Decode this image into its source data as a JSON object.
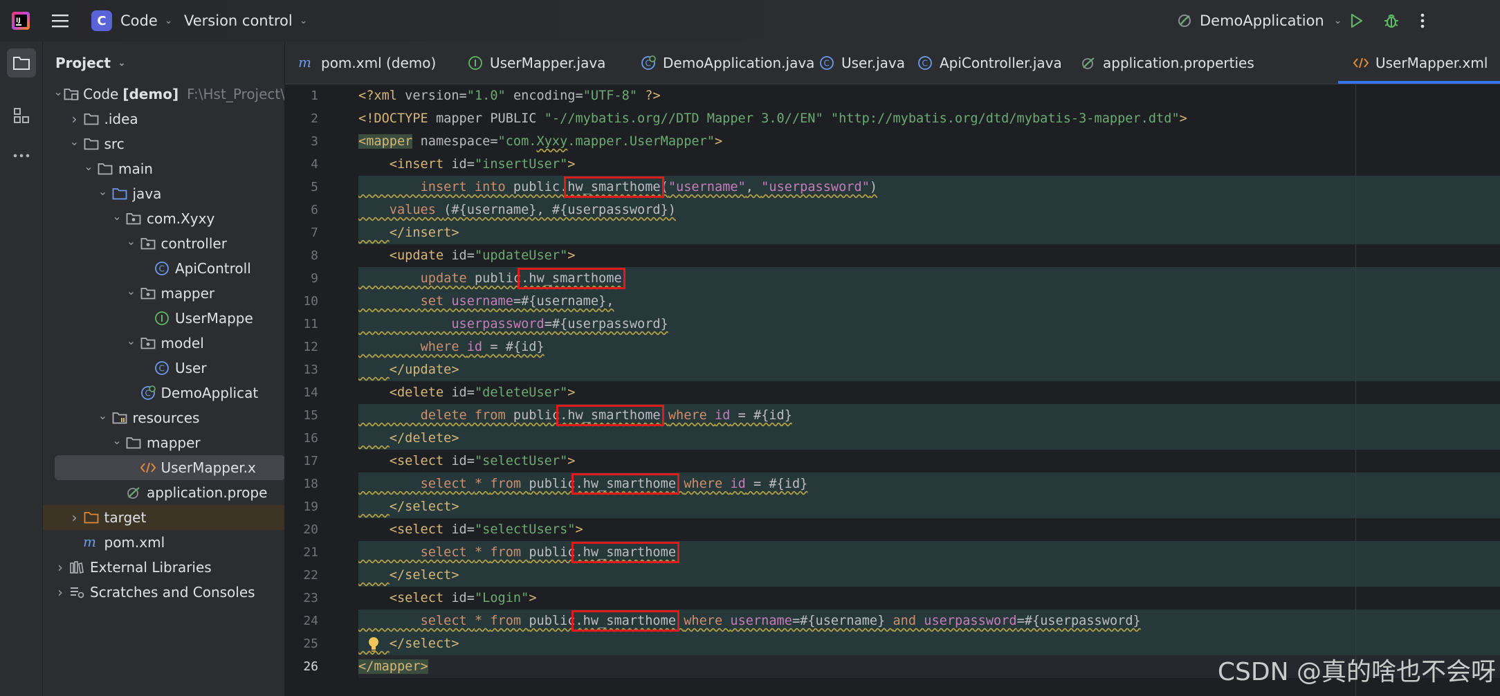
{
  "titlebar": {
    "project_initial": "C",
    "project_name": "Code",
    "vcs_label": "Version control",
    "run_config": "DemoApplication"
  },
  "project_panel": {
    "title": "Project",
    "tree": [
      {
        "label": "Code",
        "bold_suffix": "[demo]",
        "hint": "F:\\Hst_Project\\",
        "icon": "module-folder-icon",
        "expanded": true
      },
      {
        "label": ".idea",
        "icon": "folder-icon",
        "expanded": false
      },
      {
        "label": "src",
        "icon": "folder-icon",
        "expanded": true
      },
      {
        "label": "main",
        "icon": "folder-icon",
        "expanded": true
      },
      {
        "label": "java",
        "icon": "source-folder-icon",
        "expanded": true
      },
      {
        "label": "com.Xyxy",
        "icon": "package-icon",
        "expanded": true
      },
      {
        "label": "controller",
        "icon": "package-icon",
        "expanded": true
      },
      {
        "label": "ApiControll",
        "icon": "class-icon"
      },
      {
        "label": "mapper",
        "icon": "package-icon",
        "expanded": true
      },
      {
        "label": "UserMappe",
        "icon": "interface-icon"
      },
      {
        "label": "model",
        "icon": "package-icon",
        "expanded": true
      },
      {
        "label": "User",
        "icon": "class-icon"
      },
      {
        "label": "DemoApplicat",
        "icon": "spring-class-icon"
      },
      {
        "label": "resources",
        "icon": "resources-folder-icon",
        "expanded": true
      },
      {
        "label": "mapper",
        "icon": "folder-icon",
        "expanded": true
      },
      {
        "label": "UserMapper.x",
        "icon": "xml-icon"
      },
      {
        "label": "application.prope",
        "icon": "spring-properties-icon"
      },
      {
        "label": "target",
        "icon": "excluded-folder-icon",
        "expanded": false
      },
      {
        "label": "pom.xml",
        "icon": "maven-icon"
      },
      {
        "label": "External Libraries",
        "icon": "libraries-icon",
        "expanded": false
      },
      {
        "label": "Scratches and Consoles",
        "icon": "scratches-icon",
        "expanded": false
      }
    ]
  },
  "tabs": [
    {
      "label": "pom.xml (demo)",
      "icon": "maven-icon"
    },
    {
      "label": "UserMapper.java",
      "icon": "interface-icon"
    },
    {
      "label": "DemoApplication.java",
      "icon": "spring-class-icon"
    },
    {
      "label": "User.java",
      "icon": "class-icon"
    },
    {
      "label": "ApiController.java",
      "icon": "class-icon"
    },
    {
      "label": "application.properties",
      "icon": "spring-properties-icon"
    },
    {
      "label": "UserMapper.xml",
      "icon": "xml-icon",
      "active": true
    }
  ],
  "editor": {
    "line_numbers": [
      "1",
      "2",
      "3",
      "4",
      "5",
      "6",
      "7",
      "8",
      "9",
      "10",
      "11",
      "12",
      "13",
      "14",
      "15",
      "16",
      "17",
      "18",
      "19",
      "20",
      "21",
      "22",
      "23",
      "24",
      "25",
      "26"
    ],
    "lines": [
      [
        {
          "t": "<?xml ",
          "c": "t-decl"
        },
        {
          "t": "version",
          "c": "t-attr"
        },
        {
          "t": "=",
          "c": "t-txt"
        },
        {
          "t": "\"1.0\"",
          "c": "t-val"
        },
        {
          "t": " ",
          "c": "t-txt"
        },
        {
          "t": "encoding",
          "c": "t-attr"
        },
        {
          "t": "=",
          "c": "t-txt"
        },
        {
          "t": "\"UTF-8\"",
          "c": "t-val"
        },
        {
          "t": " ?>",
          "c": "t-decl"
        }
      ],
      [
        {
          "t": "<!DOCTYPE ",
          "c": "t-decl"
        },
        {
          "t": "mapper PUBLIC ",
          "c": "t-txt"
        },
        {
          "t": "\"-//mybatis.org//DTD Mapper 3.0//EN\"",
          "c": "t-val"
        },
        {
          "t": " ",
          "c": "t-txt"
        },
        {
          "t": "\"http://mybatis.org/dtd/mybatis-3-mapper.dtd\"",
          "c": "t-val"
        },
        {
          "t": ">",
          "c": "t-decl"
        }
      ],
      [
        {
          "t": "<mapper",
          "c": "t-tag hl-mapper"
        },
        {
          "t": " ",
          "c": "t-txt"
        },
        {
          "t": "namespace",
          "c": "t-attr"
        },
        {
          "t": "=",
          "c": "t-txt"
        },
        {
          "t": "\"com.",
          "c": "t-val"
        },
        {
          "t": "Xyxy",
          "c": "t-val warn"
        },
        {
          "t": ".mapper.UserMapper\"",
          "c": "t-val"
        },
        {
          "t": ">",
          "c": "t-tag"
        }
      ],
      [
        {
          "t": "    <insert ",
          "c": "t-tag"
        },
        {
          "t": "id",
          "c": "t-attr"
        },
        {
          "t": "=",
          "c": "t-txt"
        },
        {
          "t": "\"insertUser\"",
          "c": "t-val"
        },
        {
          "t": ">",
          "c": "t-tag"
        }
      ],
      [
        {
          "t": "        ",
          "c": "t-txt warn"
        },
        {
          "t": "insert into ",
          "c": "t-kw warn"
        },
        {
          "t": "public.",
          "c": "t-txt warn"
        },
        {
          "t": "hw_smarthome",
          "c": "t-txt warn redbox"
        },
        {
          "t": "(",
          "c": "t-txt warn"
        },
        {
          "t": "\"username\"",
          "c": "t-col warn"
        },
        {
          "t": ", ",
          "c": "t-txt warn"
        },
        {
          "t": "\"userpassword\"",
          "c": "t-col warn"
        },
        {
          "t": ")",
          "c": "t-txt warn"
        }
      ],
      [
        {
          "t": "    ",
          "c": "t-txt warn"
        },
        {
          "t": "values ",
          "c": "t-kw warn"
        },
        {
          "t": "(#{username}, #{userpassword})",
          "c": "t-txt warn"
        }
      ],
      [
        {
          "t": "    ",
          "c": "t-txt warn"
        },
        {
          "t": "</insert>",
          "c": "t-tag"
        }
      ],
      [
        {
          "t": "    <update ",
          "c": "t-tag"
        },
        {
          "t": "id",
          "c": "t-attr"
        },
        {
          "t": "=",
          "c": "t-txt"
        },
        {
          "t": "\"updateUser\"",
          "c": "t-val"
        },
        {
          "t": ">",
          "c": "t-tag"
        }
      ],
      [
        {
          "t": "        ",
          "c": "t-txt warn"
        },
        {
          "t": "update ",
          "c": "t-kw warn"
        },
        {
          "t": "public",
          "c": "t-txt warn"
        },
        {
          "t": ".hw_smarthome",
          "c": "t-txt warn redbox"
        }
      ],
      [
        {
          "t": "        ",
          "c": "t-txt warn"
        },
        {
          "t": "set ",
          "c": "t-kw warn"
        },
        {
          "t": "username",
          "c": "t-col warn"
        },
        {
          "t": "=#{username},",
          "c": "t-txt warn"
        }
      ],
      [
        {
          "t": "            ",
          "c": "t-txt warn"
        },
        {
          "t": "userpassword",
          "c": "t-col warn"
        },
        {
          "t": "=#{userpassword}",
          "c": "t-txt warn"
        }
      ],
      [
        {
          "t": "        ",
          "c": "t-txt warn"
        },
        {
          "t": "where ",
          "c": "t-kw warn"
        },
        {
          "t": "id",
          "c": "t-col warn"
        },
        {
          "t": " = #{id}",
          "c": "t-txt warn"
        }
      ],
      [
        {
          "t": "    ",
          "c": "t-txt warn"
        },
        {
          "t": "</update>",
          "c": "t-tag"
        }
      ],
      [
        {
          "t": "    <delete ",
          "c": "t-tag"
        },
        {
          "t": "id",
          "c": "t-attr"
        },
        {
          "t": "=",
          "c": "t-txt"
        },
        {
          "t": "\"deleteUser\"",
          "c": "t-val"
        },
        {
          "t": ">",
          "c": "t-tag"
        }
      ],
      [
        {
          "t": "        ",
          "c": "t-txt warn"
        },
        {
          "t": "delete from ",
          "c": "t-kw warn"
        },
        {
          "t": "public",
          "c": "t-txt warn"
        },
        {
          "t": ".hw_smarthome",
          "c": "t-txt warn redbox"
        },
        {
          "t": " ",
          "c": "t-txt warn"
        },
        {
          "t": "where ",
          "c": "t-kw warn"
        },
        {
          "t": "id",
          "c": "t-col warn"
        },
        {
          "t": " = #{id}",
          "c": "t-txt warn"
        }
      ],
      [
        {
          "t": "    ",
          "c": "t-txt warn"
        },
        {
          "t": "</delete>",
          "c": "t-tag"
        }
      ],
      [
        {
          "t": "    <select ",
          "c": "t-tag"
        },
        {
          "t": "id",
          "c": "t-attr"
        },
        {
          "t": "=",
          "c": "t-txt"
        },
        {
          "t": "\"selectUser\"",
          "c": "t-val"
        },
        {
          "t": ">",
          "c": "t-tag"
        }
      ],
      [
        {
          "t": "        ",
          "c": "t-txt warn"
        },
        {
          "t": "select ",
          "c": "t-kw warn"
        },
        {
          "t": "* ",
          "c": "t-kw warn"
        },
        {
          "t": "from ",
          "c": "t-kw warn"
        },
        {
          "t": "public",
          "c": "t-txt warn"
        },
        {
          "t": ".hw_smarthome",
          "c": "t-txt warn redbox"
        },
        {
          "t": " ",
          "c": "t-txt warn"
        },
        {
          "t": "where ",
          "c": "t-kw warn"
        },
        {
          "t": "id",
          "c": "t-col warn"
        },
        {
          "t": " = #{id}",
          "c": "t-txt warn"
        }
      ],
      [
        {
          "t": "    ",
          "c": "t-txt warn"
        },
        {
          "t": "</select>",
          "c": "t-tag"
        }
      ],
      [
        {
          "t": "    <select ",
          "c": "t-tag"
        },
        {
          "t": "id",
          "c": "t-attr"
        },
        {
          "t": "=",
          "c": "t-txt"
        },
        {
          "t": "\"selectUsers\"",
          "c": "t-val"
        },
        {
          "t": ">",
          "c": "t-tag"
        }
      ],
      [
        {
          "t": "        ",
          "c": "t-txt warn"
        },
        {
          "t": "select ",
          "c": "t-kw warn"
        },
        {
          "t": "* ",
          "c": "t-kw warn"
        },
        {
          "t": "from ",
          "c": "t-kw warn"
        },
        {
          "t": "public",
          "c": "t-txt warn"
        },
        {
          "t": ".hw_smarthome",
          "c": "t-txt warn redbox"
        }
      ],
      [
        {
          "t": "    ",
          "c": "t-txt warn"
        },
        {
          "t": "</select>",
          "c": "t-tag"
        }
      ],
      [
        {
          "t": "    <select ",
          "c": "t-tag"
        },
        {
          "t": "id",
          "c": "t-attr"
        },
        {
          "t": "=",
          "c": "t-txt"
        },
        {
          "t": "\"Login\"",
          "c": "t-val"
        },
        {
          "t": ">",
          "c": "t-tag"
        }
      ],
      [
        {
          "t": "        ",
          "c": "t-txt warn"
        },
        {
          "t": "select ",
          "c": "t-kw warn"
        },
        {
          "t": "* ",
          "c": "t-kw warn"
        },
        {
          "t": "from ",
          "c": "t-kw warn"
        },
        {
          "t": "public",
          "c": "t-txt warn"
        },
        {
          "t": ".hw_smarthome",
          "c": "t-txt warn redbox"
        },
        {
          "t": " ",
          "c": "t-txt warn"
        },
        {
          "t": "where ",
          "c": "t-kw warn"
        },
        {
          "t": "username",
          "c": "t-col warn"
        },
        {
          "t": "=#{username} ",
          "c": "t-txt warn"
        },
        {
          "t": "and ",
          "c": "t-kw warn"
        },
        {
          "t": "userpassword",
          "c": "t-col warn"
        },
        {
          "t": "=#{userpassword}",
          "c": "t-txt warn"
        }
      ],
      [
        {
          "t": "    ",
          "c": "t-txt warn"
        },
        {
          "t": "</select>",
          "c": "t-tag"
        }
      ],
      [
        {
          "t": "</mapper>",
          "c": "t-tag hl-mapper"
        }
      ]
    ],
    "injected_lines": [
      5,
      6,
      7,
      9,
      10,
      11,
      12,
      13,
      15,
      16,
      18,
      19,
      21,
      22,
      24,
      25
    ],
    "current_line": 26,
    "bulb_line": 25
  },
  "watermark": "CSDN @真的啥也不会呀",
  "colors": {
    "accent": "#3574f0",
    "redbox": "#e01b1b",
    "run_green": "#5fb865",
    "spring_green": "#6aab73"
  }
}
